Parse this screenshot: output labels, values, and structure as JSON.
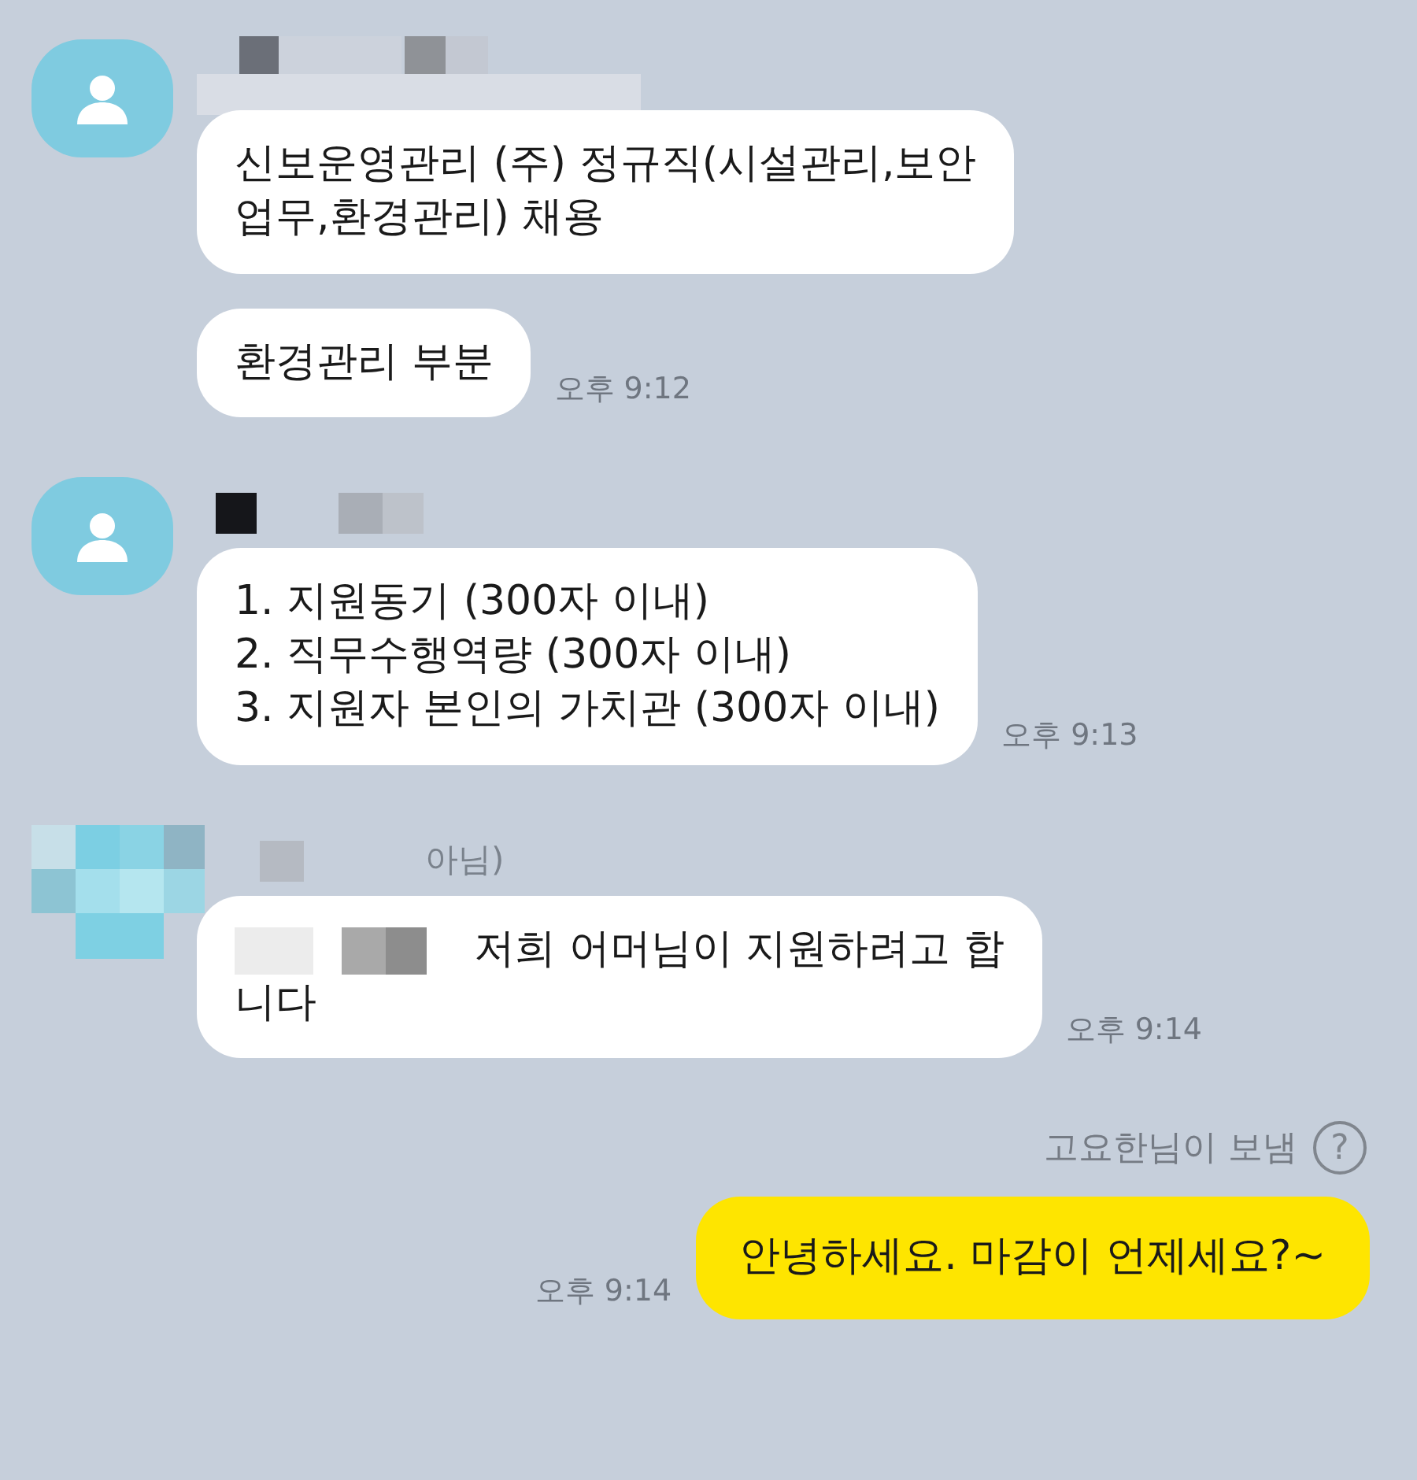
{
  "groups": [
    {
      "kind": "received",
      "avatar_pixelated": false,
      "messages": [
        {
          "text": "신보운영관리 (주) 정규직(시설관리,보안\n업무,환경관리) 채용"
        },
        {
          "text": "환경관리 부분",
          "time": "오후 9:12"
        }
      ]
    },
    {
      "kind": "received",
      "avatar_pixelated": false,
      "messages": [
        {
          "text": "1. 지원동기 (300자 이내)\n2. 직무수행역량 (300자 이내)\n3. 지원자 본인의 가치관 (300자 이내)",
          "time": "오후 9:13"
        }
      ]
    },
    {
      "kind": "received",
      "avatar_pixelated": true,
      "name_visible": "아님)",
      "messages": [
        {
          "text": "저희 어머님이 지원하려고 합\n니다",
          "time": "오후 9:14",
          "redacted_start": true
        }
      ]
    },
    {
      "kind": "notice",
      "text": "고요한님이 보냄",
      "help": "?"
    },
    {
      "kind": "sent",
      "messages": [
        {
          "text": "안녕하세요. 마감이 언제세요?~",
          "time": "오후 9:14"
        }
      ]
    }
  ]
}
